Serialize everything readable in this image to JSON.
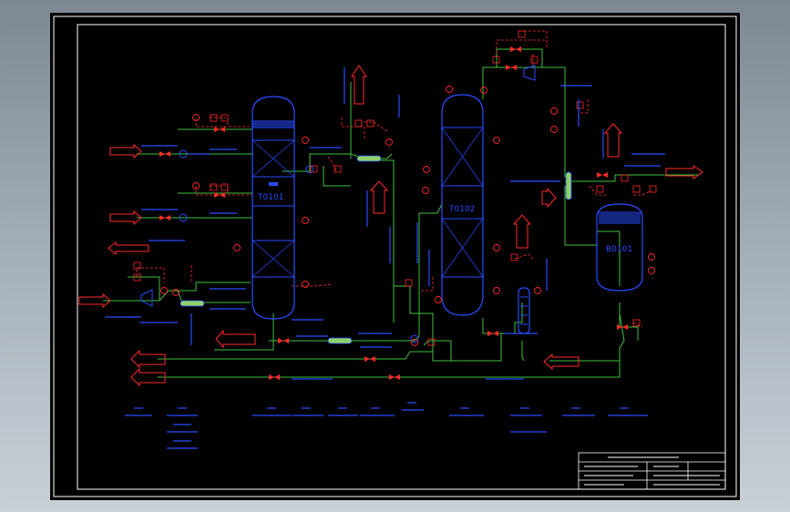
{
  "colors": {
    "background": "#000000",
    "frame": "#ffffff",
    "equipment": "#2a4cff",
    "process_line": "#3fbf3f",
    "instrument": "#ff2a2a",
    "signal": "#ff3030",
    "exchanger": "#8fd16a",
    "text": "#2a4cff"
  },
  "equipment": {
    "column_1": "T0101",
    "column_2": "T0102",
    "drum": "B0101"
  }
}
